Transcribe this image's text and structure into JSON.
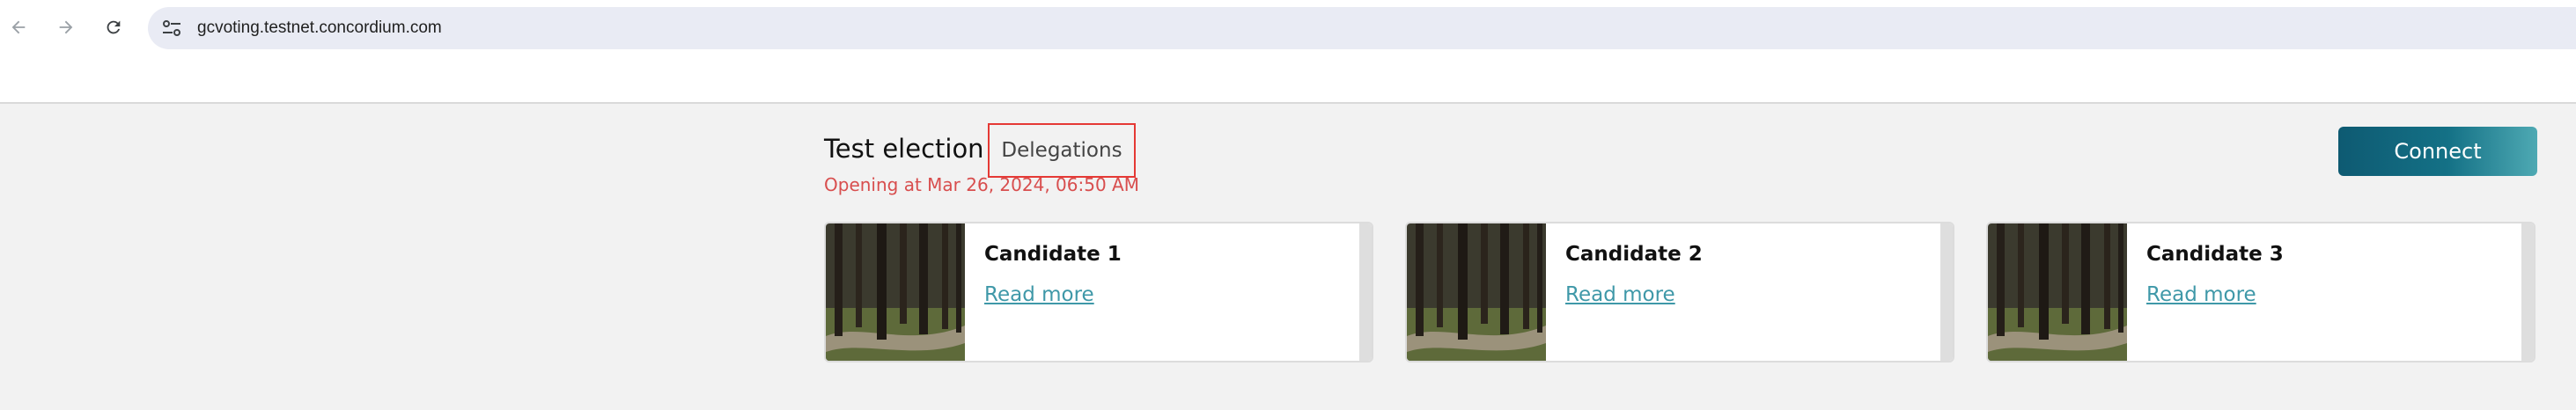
{
  "browser": {
    "url": "gcvoting.testnet.concordium.com",
    "icons": [
      "back-arrow-icon",
      "forward-arrow-icon",
      "reload-icon",
      "site-settings-icon"
    ]
  },
  "election": {
    "title": "Test election",
    "tab_label": "Delegations",
    "opening_text": "Opening at Mar 26, 2024, 06:50 AM",
    "connect_label": "Connect"
  },
  "colors": {
    "accent": "#147186",
    "opening": "#d84e4e",
    "highlight": "#e53935",
    "link": "#3f98a8"
  },
  "candidates": [
    {
      "name": "Candidate 1",
      "link": "Read more"
    },
    {
      "name": "Candidate 2",
      "link": "Read more"
    },
    {
      "name": "Candidate 3",
      "link": "Read more"
    }
  ]
}
